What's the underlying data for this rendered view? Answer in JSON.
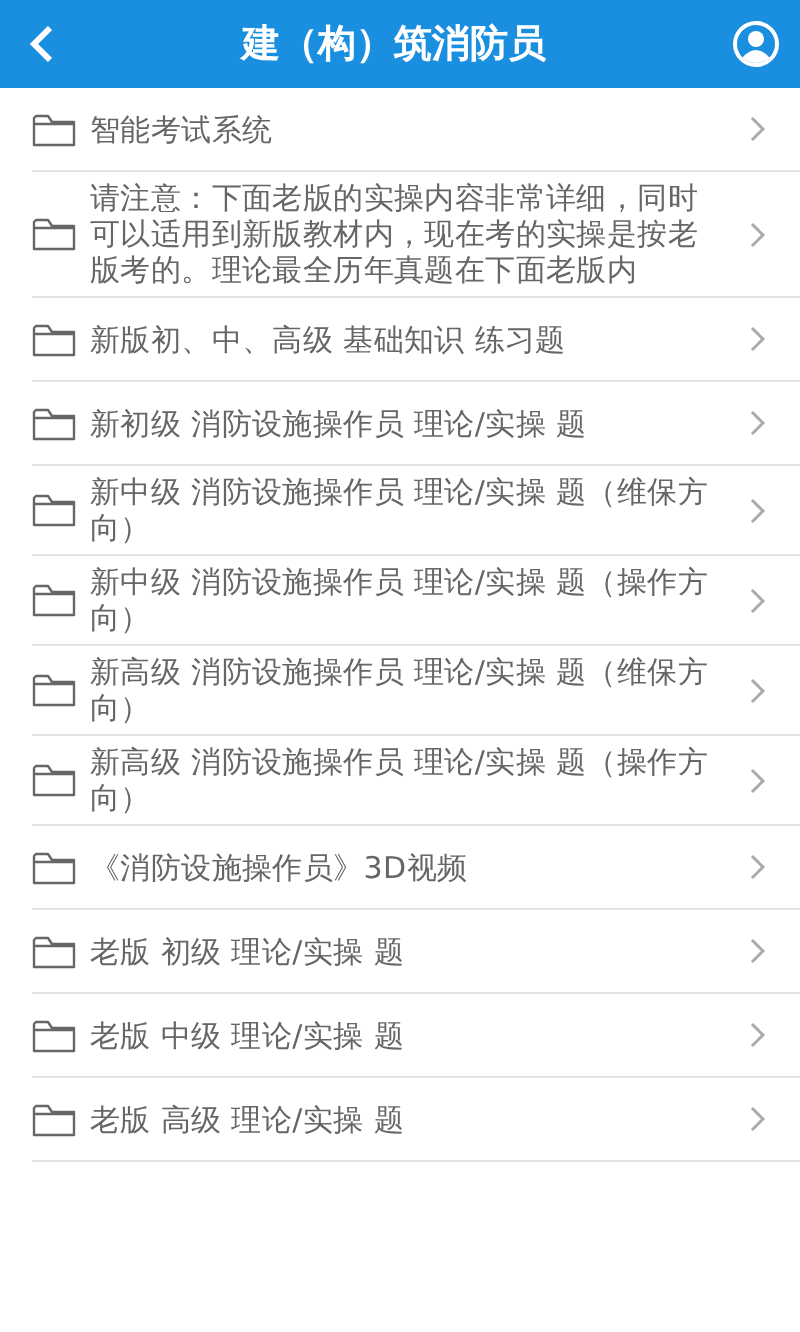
{
  "header": {
    "title": "建（构）筑消防员"
  },
  "items": [
    {
      "label": "智能考试系统"
    },
    {
      "label": "请注意：下面老版的实操内容非常详细，同时可以适用到新版教材内，现在考的实操是按老版考的。理论最全历年真题在下面老版内"
    },
    {
      "label": "新版初、中、高级 基础知识 练习题"
    },
    {
      "label": "新初级 消防设施操作员 理论/实操 题"
    },
    {
      "label": "新中级 消防设施操作员 理论/实操 题（维保方向）"
    },
    {
      "label": "新中级 消防设施操作员 理论/实操 题（操作方向）"
    },
    {
      "label": "新高级 消防设施操作员 理论/实操 题（维保方向）"
    },
    {
      "label": "新高级 消防设施操作员 理论/实操 题（操作方向）"
    },
    {
      "label": "《消防设施操作员》3D视频"
    },
    {
      "label": "老版 初级 理论/实操 题"
    },
    {
      "label": "老版 中级 理论/实操 题"
    },
    {
      "label": "老版 高级 理论/实操 题"
    }
  ]
}
